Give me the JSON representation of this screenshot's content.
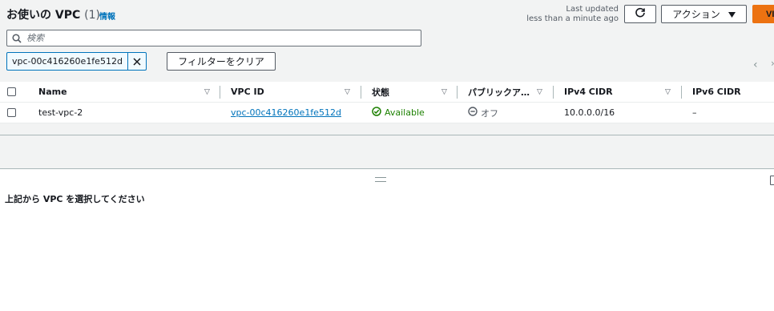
{
  "header": {
    "title": "お使いの VPC",
    "count": "(1)",
    "info_link": "情報",
    "last_updated_label": "Last updated",
    "last_updated_value": "less than a minute ago",
    "actions_label": "アクション",
    "create_label": "VI"
  },
  "search": {
    "placeholder": "検索",
    "value": ""
  },
  "filter": {
    "token_value": "vpc-00c416260e1fe512d",
    "clear_label": "フィルターをクリア"
  },
  "table": {
    "columns": [
      "Name",
      "VPC ID",
      "状態",
      "パブリックア…",
      "IPv4 CIDR",
      "IPv6 CIDR"
    ],
    "rows": [
      {
        "name": "test-vpc-2",
        "vpc_id": "vpc-00c416260e1fe512d",
        "state": "Available",
        "public_access": "オフ",
        "ipv4_cidr": "10.0.0.0/16",
        "ipv6_cidr": "–"
      }
    ]
  },
  "details": {
    "empty_message": "上記から VPC を選択してください"
  },
  "colors": {
    "accent_link": "#0073bb",
    "status_available": "#1d8102",
    "primary_button": "#ec7211"
  },
  "icons": {
    "search": "search-icon",
    "refresh": "refresh-icon",
    "dropdown": "caret-down-icon",
    "close": "close-icon",
    "sort": "sort-icon",
    "status_ok": "check-circle-icon",
    "status_off": "minus-circle-icon",
    "pager_prev": "chevron-left-icon",
    "pager_next": "chevron-right-icon",
    "resize": "resize-handle-icon",
    "panel": "panel-toggle-icon"
  }
}
